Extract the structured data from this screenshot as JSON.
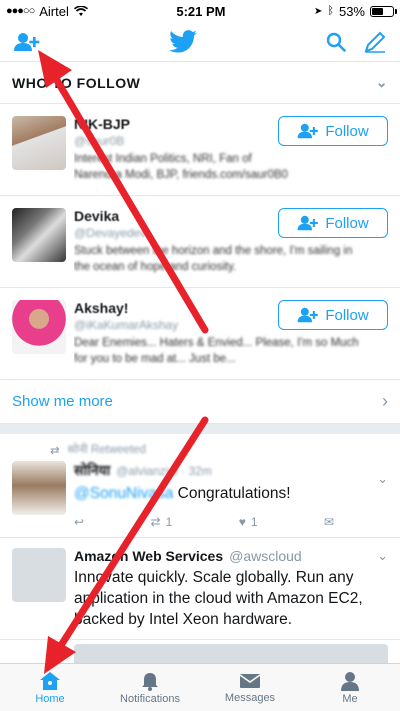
{
  "status_bar": {
    "carrier": "Airtel",
    "time": "5:21 PM",
    "battery_text": "53%",
    "battery_level": 0.53
  },
  "navbar": {
    "left_icon": "add-user-icon",
    "center_icon": "twitter-bird-icon",
    "right_icons": [
      "search-icon",
      "compose-icon"
    ],
    "brand_color": "#1da1f2"
  },
  "who_to_follow": {
    "title": "WHO TO FOLLOW",
    "suggestions": [
      {
        "name": "NIK-BJP",
        "handle": "@saur0B",
        "bio": "Interest Indian Politics, NRI, Fan of Narendra Modi, BJP, friends.com/saur0B0",
        "follow_label": "Follow"
      },
      {
        "name": "Devika",
        "handle": "@Devayedevi",
        "bio": "Stuck between the horizon and the shore, I'm sailing in the ocean of hope and curiosity.",
        "follow_label": "Follow"
      },
      {
        "name": "Akshay!",
        "handle": "@iKaKumarAkshay",
        "bio": "Dear Enemies... Haters & Envied... Please, I'm so Much for you to be mad at... Just be...",
        "follow_label": "Follow"
      }
    ],
    "show_more": "Show me more"
  },
  "timeline": [
    {
      "retweet_by": "सोनी Retweeted",
      "name": "सोनिया",
      "handle": "@alvianziel · 32m",
      "mention": "@SonuNivasa",
      "text": "Congratulations!",
      "retweets": "1",
      "likes": "1"
    },
    {
      "name": "Amazon Web Services",
      "handle": "@awscloud",
      "text": "Innovate quickly. Scale globally.  Run any application in the cloud with Amazon EC2, backed by Intel Xeon hardware."
    }
  ],
  "tabbar": {
    "tabs": [
      {
        "label": "Home",
        "icon": "home-icon",
        "active": true
      },
      {
        "label": "Notifications",
        "icon": "bell-icon",
        "active": false
      },
      {
        "label": "Messages",
        "icon": "envelope-icon",
        "active": false
      },
      {
        "label": "Me",
        "icon": "person-icon",
        "active": false
      }
    ]
  },
  "annotation_color": "#e8222a"
}
